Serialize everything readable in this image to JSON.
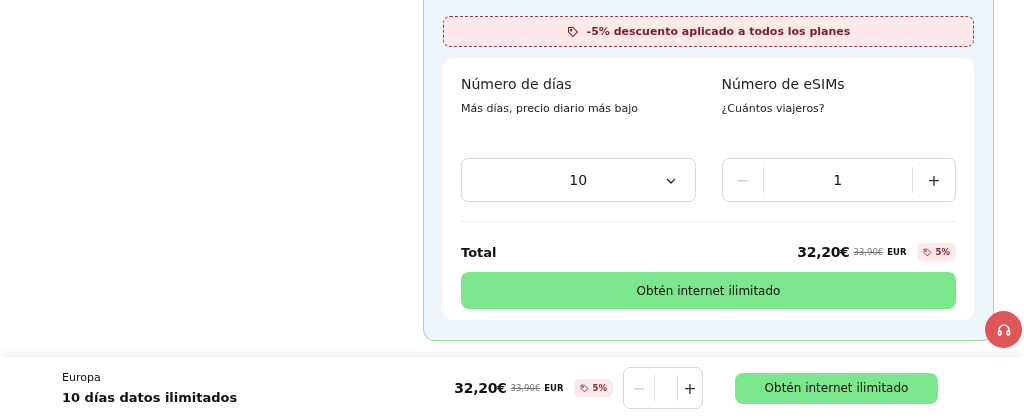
{
  "discount_banner": {
    "text": "-5% descuento aplicado a todos los planes"
  },
  "days": {
    "title": "Número de días",
    "subtitle": "Más días, precio diario más bajo",
    "value": "10"
  },
  "esims": {
    "title": "Número de eSIMs",
    "subtitle": "¿Cuántos viajeros?",
    "value": "1",
    "minus": "−",
    "plus": "+",
    "minus_disabled": true
  },
  "total": {
    "label": "Total",
    "price": "32,20€",
    "old_price": "33,90€",
    "currency": "EUR",
    "discount": "5%"
  },
  "cta": "Obtén internet ilimitado",
  "bottom_bar": {
    "region": "Europa",
    "plan": "10 días datos ilimitados",
    "price": "32,20€",
    "old_price": "33,90€",
    "currency": "EUR",
    "discount": "5%",
    "minus": "−",
    "plus": "+",
    "minus_disabled": true,
    "cta": "Obtén internet ilimitado"
  }
}
